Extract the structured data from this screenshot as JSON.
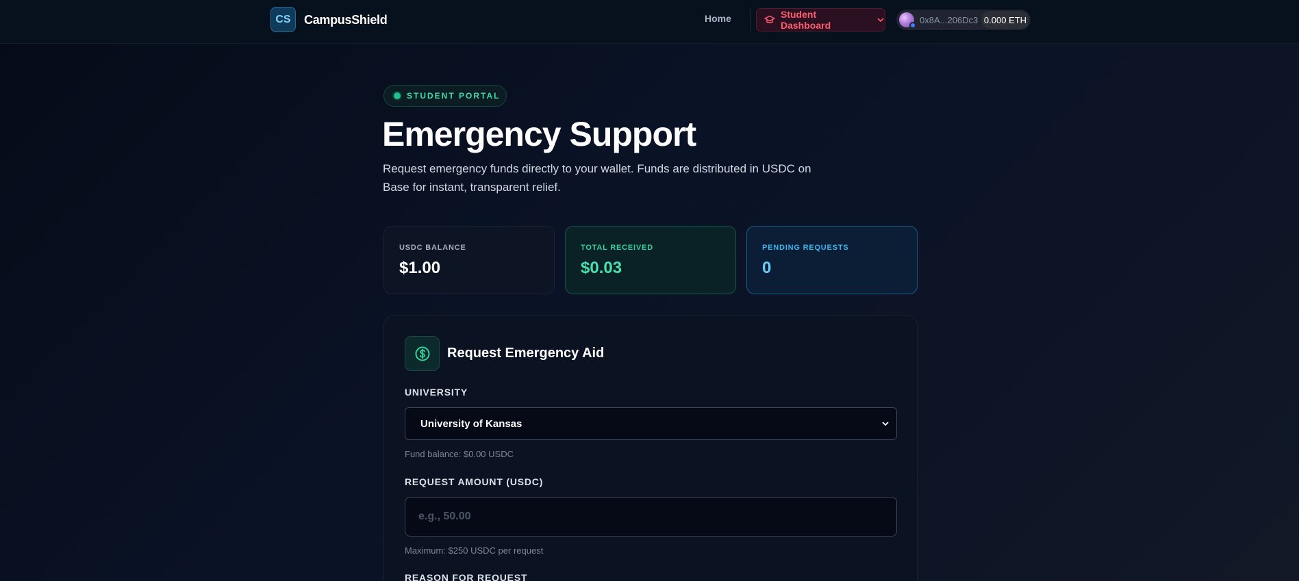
{
  "nav": {
    "logo_badge": "CS",
    "brand": "CampusShield",
    "home": "Home",
    "dashboard": "Student Dashboard",
    "wallet_address": "0x8A...206Dc3",
    "wallet_balance": "0.000 ETH"
  },
  "header": {
    "pill": "STUDENT PORTAL",
    "title": "Emergency Support",
    "subtitle": "Request emergency funds directly to your wallet. Funds are distributed in USDC on Base for instant, transparent relief."
  },
  "stats": [
    {
      "label": "USDC BALANCE",
      "value": "$1.00"
    },
    {
      "label": "TOTAL RECEIVED",
      "value": "$0.03"
    },
    {
      "label": "PENDING REQUESTS",
      "value": "0"
    }
  ],
  "form": {
    "title": "Request Emergency Aid",
    "university_label": "UNIVERSITY",
    "university_value": "University of Kansas",
    "fund_balance": "Fund balance: $0.00 USDC",
    "amount_label": "REQUEST AMOUNT (USDC)",
    "amount_placeholder": "e.g., 50.00",
    "amount_hint": "Maximum: $250 USDC per request",
    "reason_label": "REASON FOR REQUEST"
  },
  "colors": {
    "accent_green": "#47e0ae",
    "accent_blue": "#6ccdfb",
    "accent_red": "#ff5d6e"
  }
}
